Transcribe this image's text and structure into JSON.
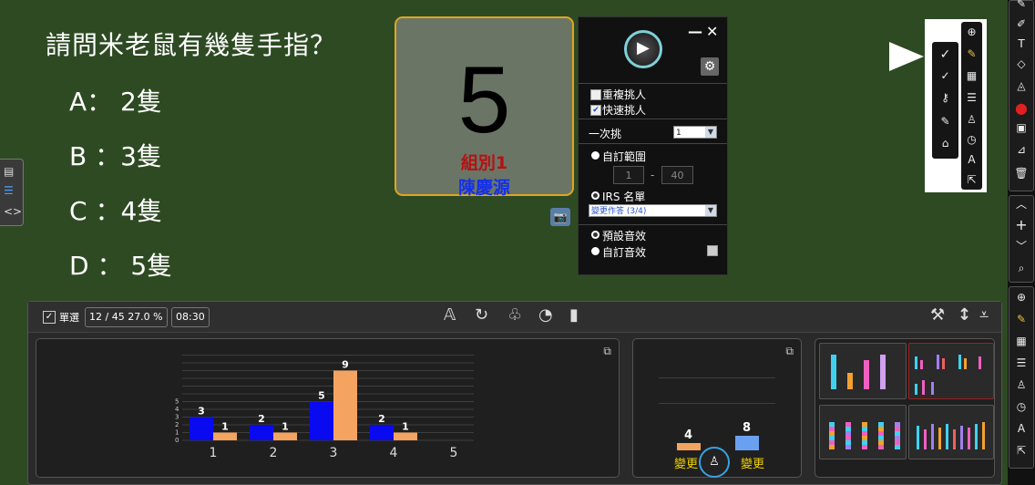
{
  "question": {
    "title": "請問米老鼠有幾隻手指？",
    "options": [
      "A：  2隻",
      "B ：3隻",
      "C ：4隻",
      "D ：  5隻"
    ]
  },
  "picker_card": {
    "number": "5",
    "group": "組別1",
    "name": "陳慶源"
  },
  "picker_panel": {
    "minimize": "—",
    "close": "✕",
    "repeat_pick": "重複挑人",
    "quick_pick": "快速挑人",
    "repeat_checked": false,
    "quick_checked": true,
    "pick_count_label": "一次挑",
    "pick_count_value": "1",
    "custom_range_label": "自訂範圍",
    "range_from": "1",
    "range_dash": "-",
    "range_to": "40",
    "irs_label": "IRS 名單",
    "irs_value": "變更作答 (3/4)",
    "default_sound": "預設音效",
    "custom_sound": "自訂音效"
  },
  "response_toolbar": {
    "single_select": "單選",
    "count_rate": "12 / 45   27.0 %",
    "timer": "08:30"
  },
  "chart_data": {
    "type": "bar",
    "categories": [
      "1",
      "2",
      "3",
      "4",
      "5"
    ],
    "series": [
      {
        "values": [
          3,
          2,
          5,
          2,
          0
        ]
      },
      {
        "values": [
          1,
          1,
          9,
          1,
          0
        ]
      }
    ],
    "ylim": [
      0,
      5
    ],
    "yticks": [
      "0",
      "1",
      "2",
      "3",
      "4",
      "5"
    ],
    "colors": [
      "#0a0af0",
      "#f4a460"
    ]
  },
  "summary_chart": {
    "values": [
      "4",
      "8"
    ],
    "labels": [
      "變更",
      "變更"
    ],
    "colors": [
      "#f4a460",
      "#6aa0f0"
    ]
  },
  "colors": {
    "background": "#2e4a23",
    "card_border": "#e0a51e",
    "accent_orange": "#f4a460",
    "accent_blue": "#0a0af0"
  }
}
